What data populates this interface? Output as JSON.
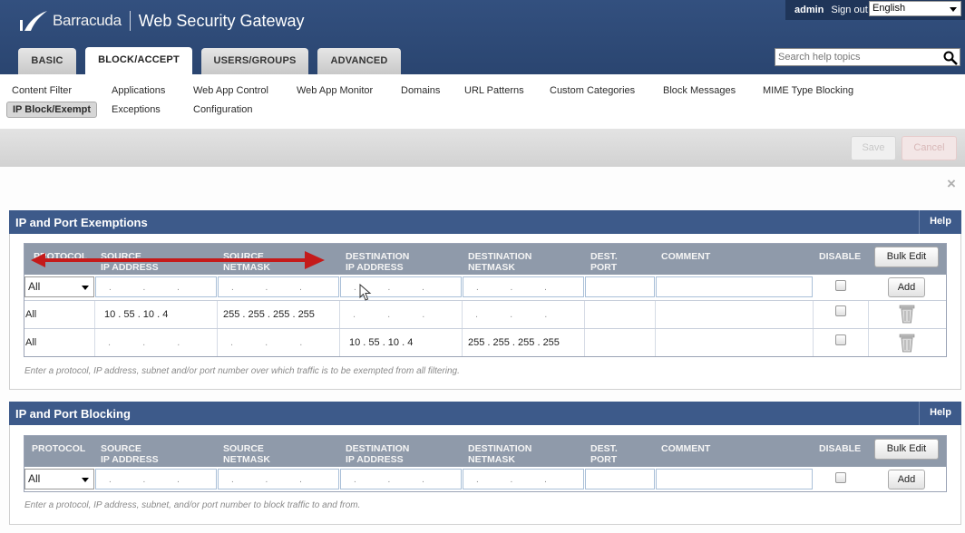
{
  "header": {
    "brand": "Barracuda",
    "product": "Web Security Gateway",
    "user": "admin",
    "signout": "Sign out",
    "language": "English",
    "search_placeholder": "Search help topics"
  },
  "tabs": [
    "BASIC",
    "BLOCK/ACCEPT",
    "USERS/GROUPS",
    "ADVANCED"
  ],
  "active_tab": "BLOCK/ACCEPT",
  "subnav": {
    "row1": [
      "Content Filter",
      "Applications",
      "Web App Control",
      "Web App Monitor",
      "Domains",
      "URL Patterns",
      "Custom Categories",
      "Block Messages",
      "MIME Type Blocking"
    ],
    "row2": [
      "IP Block/Exempt",
      "Exceptions",
      "Configuration"
    ],
    "active": "IP Block/Exempt"
  },
  "actions": {
    "save": "Save",
    "cancel": "Cancel"
  },
  "close_glyph": "×",
  "exemptions": {
    "title": "IP and Port Exemptions",
    "help": "Help",
    "columns": {
      "protocol": "PROTOCOL",
      "source_ip": "SOURCE\nIP ADDRESS",
      "source_netmask": "SOURCE\nNETMASK",
      "dest_ip": "DESTINATION\nIP ADDRESS",
      "dest_netmask": "DESTINATION\nNETMASK",
      "dest_port": "DEST.\nPORT",
      "comment": "COMMENT",
      "disable": "DISABLE"
    },
    "bulk_edit": "Bulk Edit",
    "protocol_value": "All",
    "add": "Add",
    "rows": [
      {
        "protocol": "All",
        "source_ip": "10 . 55 . 10 . 4",
        "source_netmask": "255 . 255 . 255 . 255",
        "dest_ip": "",
        "dest_netmask": "",
        "dest_port": "",
        "comment": ""
      },
      {
        "protocol": "All",
        "source_ip": "",
        "source_netmask": "",
        "dest_ip": "10 . 55 . 10 . 4",
        "dest_netmask": "255 . 255 . 255 . 255",
        "dest_port": "",
        "comment": ""
      }
    ],
    "hint": "Enter a protocol, IP address, subnet and/or port number over which traffic is to be exempted from all filtering."
  },
  "blocking": {
    "title": "IP and Port Blocking",
    "help": "Help",
    "columns": {
      "protocol": "PROTOCOL",
      "source_ip": "SOURCE\nIP ADDRESS",
      "source_netmask": "SOURCE\nNETMASK",
      "dest_ip": "DESTINATION\nIP ADDRESS",
      "dest_netmask": "DESTINATION\nNETMASK",
      "dest_port": "DEST.\nPORT",
      "comment": "COMMENT",
      "disable": "DISABLE"
    },
    "bulk_edit": "Bulk Edit",
    "protocol_value": "All",
    "add": "Add",
    "hint": "Enter a protocol, IP address, subnet, and/or port number to block traffic to and from."
  },
  "ip_placeholder_dots": ". . ."
}
